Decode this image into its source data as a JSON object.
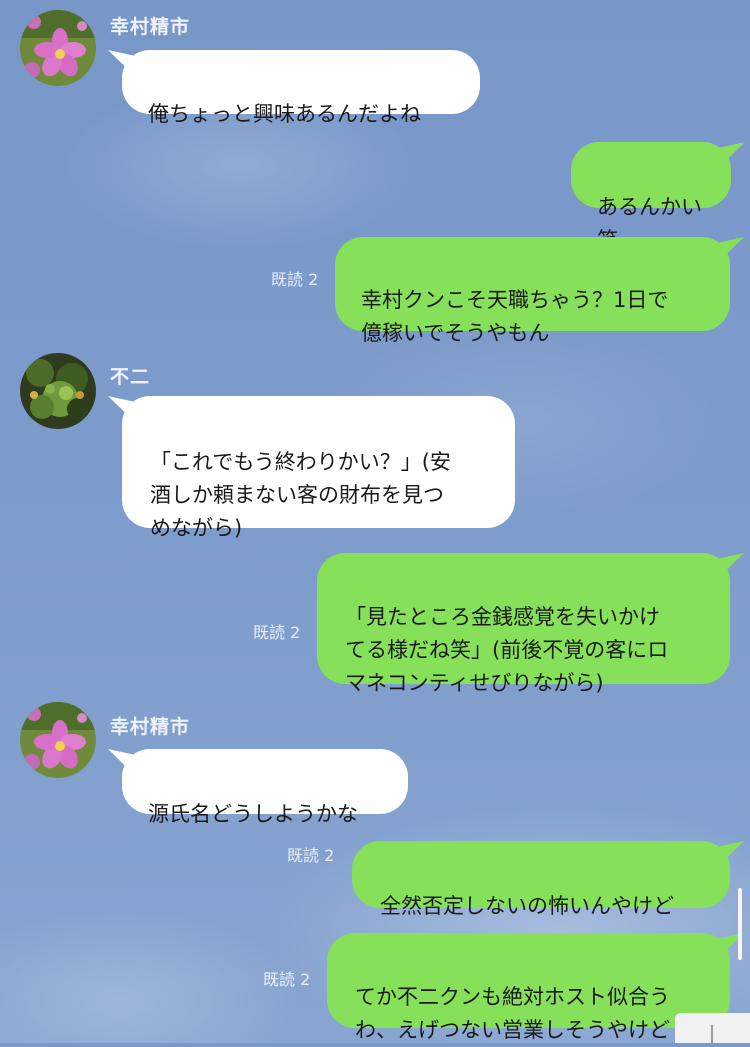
{
  "messages": [
    {
      "side": "left",
      "sender": "幸村精市",
      "avatar": "cosmos-flower-avatar",
      "text": "俺ちょっと興味あるんだよね"
    },
    {
      "side": "right",
      "read": "",
      "text": "あるんかい笑"
    },
    {
      "side": "right",
      "read": "既読 2",
      "text": "幸村クンこそ天職ちゃう？1日で\n億稼いでそうやもん"
    },
    {
      "side": "left",
      "sender": "不二",
      "avatar": "green-plant-avatar",
      "text": "「これでもう終わりかい？」(安\n酒しか頼まない客の財布を見つ\nめながら)"
    },
    {
      "side": "right",
      "read": "既読 2",
      "text": "「見たところ金銭感覚を失いかけ\nてる様だね笑」(前後不覚の客にロ\nマネコンティせびりながら)"
    },
    {
      "side": "left",
      "sender": "幸村精市",
      "avatar": "cosmos-flower-avatar",
      "text": "源氏名どうしようかな"
    },
    {
      "side": "right",
      "read": "既読 2",
      "text": "全然否定しないの怖いんやけど"
    },
    {
      "side": "right",
      "read": "既読 2",
      "text": "てか不二クンも絶対ホスト似合う\nわ、えげつない営業しそうやけど"
    }
  ],
  "colors": {
    "background": "#7b9ac9",
    "bubble_left": "#ffffff",
    "bubble_right": "#86e05a",
    "sender_text": "#eef3fb",
    "read_text": "#e8eef8"
  }
}
